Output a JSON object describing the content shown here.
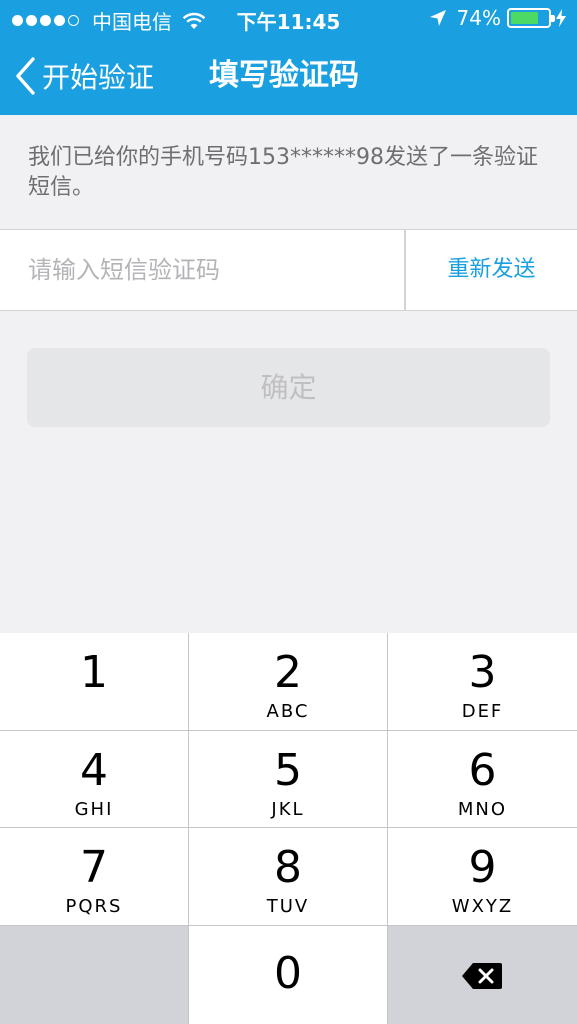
{
  "status": {
    "carrier": "中国电信",
    "time": "下午11:45",
    "battery": "74%",
    "battery_level": 0.74,
    "icons": [
      "signal-dots",
      "wifi-icon",
      "location-arrow-icon",
      "battery-icon",
      "charging-bolt-icon"
    ]
  },
  "nav": {
    "back_label": "开始验证",
    "title": "填写验证码",
    "back_icon": "chevron-left-icon"
  },
  "info": {
    "text": "我们已给你的手机号码153******98发送了一条验证短信。"
  },
  "form": {
    "code_placeholder": "请输入短信验证码",
    "resend_label": "重新发送",
    "confirm_label": "确定"
  },
  "keypad": {
    "keys": [
      {
        "digit": "1",
        "letters": ""
      },
      {
        "digit": "2",
        "letters": "ABC"
      },
      {
        "digit": "3",
        "letters": "DEF"
      },
      {
        "digit": "4",
        "letters": "GHI"
      },
      {
        "digit": "5",
        "letters": "JKL"
      },
      {
        "digit": "6",
        "letters": "MNO"
      },
      {
        "digit": "7",
        "letters": "PQRS"
      },
      {
        "digit": "8",
        "letters": "TUV"
      },
      {
        "digit": "9",
        "letters": "WXYZ"
      },
      {
        "digit": "0",
        "letters": ""
      }
    ],
    "delete_icon": "backspace-icon"
  },
  "colors": {
    "accent": "#1aa0e0",
    "battery_fill": "#4cd964",
    "background": "#f1f1f3",
    "confirm_disabled": "#e5e6e8"
  }
}
